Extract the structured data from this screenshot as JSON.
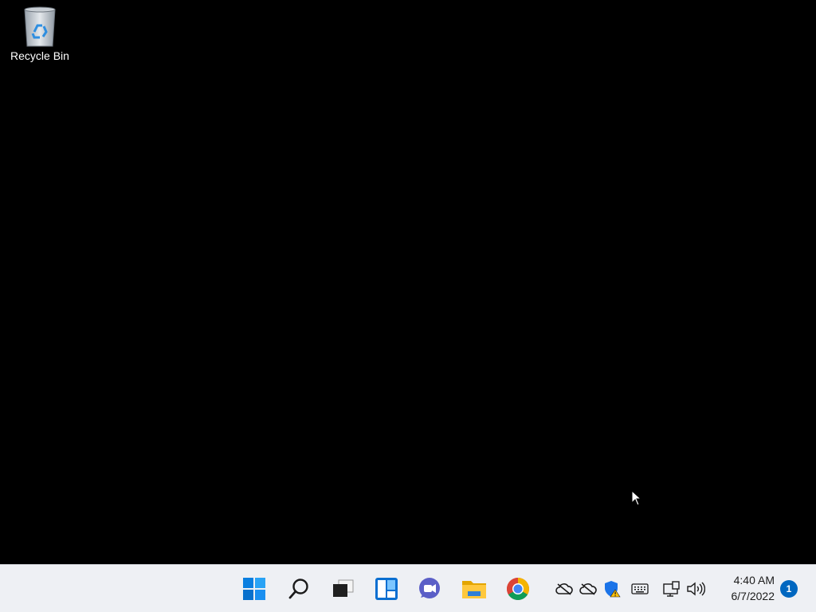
{
  "desktop": {
    "icons": [
      {
        "label": "Recycle Bin",
        "icon": "recycle-bin-icon"
      }
    ]
  },
  "taskbar": {
    "apps": [
      {
        "name": "Start",
        "icon": "windows-start-icon"
      },
      {
        "name": "Search",
        "icon": "search-icon"
      },
      {
        "name": "Task View",
        "icon": "task-view-icon"
      },
      {
        "name": "Widgets",
        "icon": "widgets-icon"
      },
      {
        "name": "Chat",
        "icon": "teams-chat-icon"
      },
      {
        "name": "File Explorer",
        "icon": "folder-icon"
      },
      {
        "name": "Google Chrome",
        "icon": "chrome-icon"
      }
    ],
    "tray": [
      {
        "icon": "onedrive-offline-icon"
      },
      {
        "icon": "onedrive-offline-icon"
      },
      {
        "icon": "security-warning-icon"
      },
      {
        "icon": "keyboard-icon"
      },
      {
        "icon": "network-icon"
      },
      {
        "icon": "volume-icon"
      }
    ],
    "clock": {
      "time": "4:40 AM",
      "date": "6/7/2022"
    },
    "notification_count": "1"
  },
  "colors": {
    "desktop_bg": "#000000",
    "taskbar_bg": "#eef0f4",
    "accent": "#0067c0"
  }
}
